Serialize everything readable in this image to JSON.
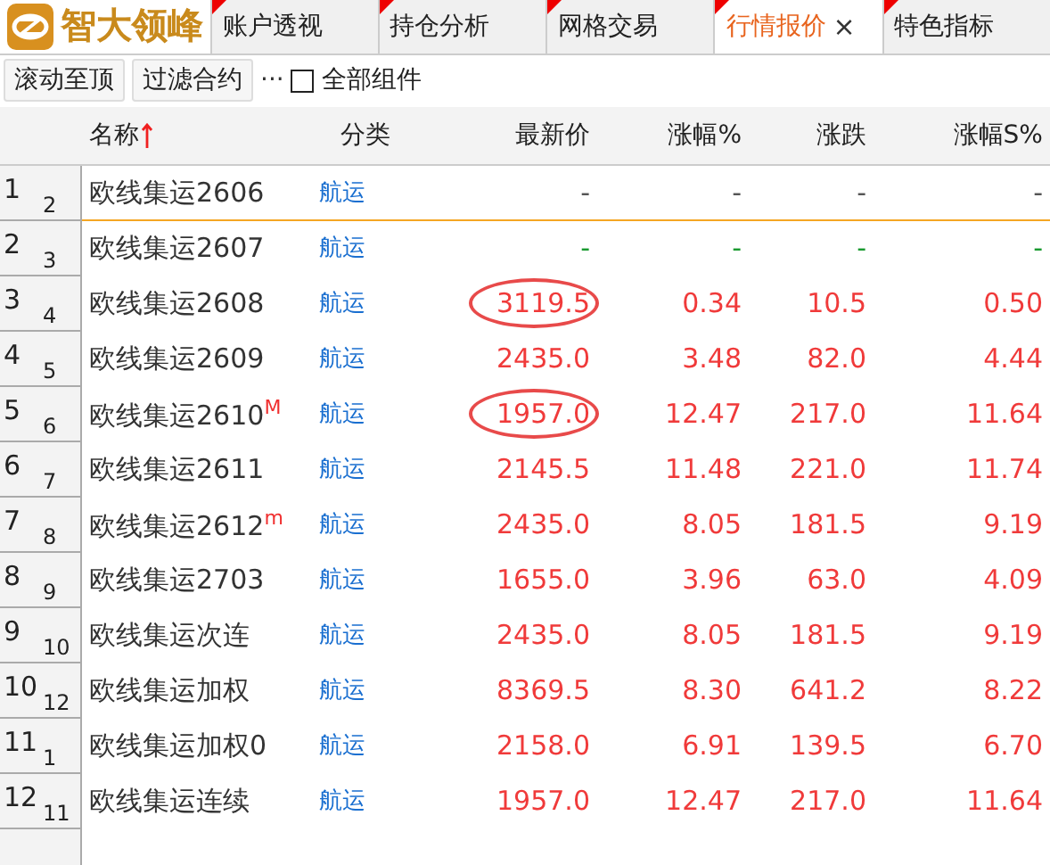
{
  "logo": {
    "text": "智大领峰"
  },
  "tabs": [
    {
      "label": "账户透视",
      "selected": false
    },
    {
      "label": "持仓分析",
      "selected": false
    },
    {
      "label": "网格交易",
      "selected": false
    },
    {
      "label": "行情报价",
      "selected": true,
      "close": "×"
    },
    {
      "label": "特色指标",
      "selected": false
    }
  ],
  "toolbar": {
    "buttons": [
      "滚动至顶",
      "过滤合约"
    ],
    "more": "···",
    "checkbox": {
      "label": "全部组件",
      "checked": false
    }
  },
  "table": {
    "columns": [
      {
        "label": "名称",
        "sorted": true
      },
      {
        "label": "分类",
        "sorted": false
      },
      {
        "label": "最新价",
        "sorted": false
      },
      {
        "label": "涨幅%",
        "sorted": false
      },
      {
        "label": "涨跌",
        "sorted": false
      },
      {
        "label": "涨幅S%",
        "sorted": false
      }
    ],
    "rows": [
      {
        "index": "1",
        "sub": "2",
        "name": "欧线集运2606",
        "mark": "",
        "category": "航运",
        "price": "-",
        "pct": "-",
        "change": "-",
        "pct_s": "-",
        "color": "#555555",
        "circled": false,
        "selected": true
      },
      {
        "index": "2",
        "sub": "3",
        "name": "欧线集运2607",
        "mark": "",
        "category": "航运",
        "price": "-",
        "pct": "-",
        "change": "-",
        "pct_s": "-",
        "color": "#1a9a30",
        "circled": false,
        "selected": false
      },
      {
        "index": "3",
        "sub": "4",
        "name": "欧线集运2608",
        "mark": "",
        "category": "航运",
        "price": "3119.5",
        "pct": "0.34",
        "change": "10.5",
        "pct_s": "0.50",
        "color": "#f03a3a",
        "circled": true,
        "selected": false
      },
      {
        "index": "4",
        "sub": "5",
        "name": "欧线集运2609",
        "mark": "",
        "category": "航运",
        "price": "2435.0",
        "pct": "3.48",
        "change": "82.0",
        "pct_s": "4.44",
        "color": "#f03a3a",
        "circled": false,
        "selected": false
      },
      {
        "index": "5",
        "sub": "6",
        "name": "欧线集运2610",
        "mark": "M",
        "category": "航运",
        "price": "1957.0",
        "pct": "12.47",
        "change": "217.0",
        "pct_s": "11.64",
        "color": "#f03a3a",
        "circled": true,
        "selected": false
      },
      {
        "index": "6",
        "sub": "7",
        "name": "欧线集运2611",
        "mark": "",
        "category": "航运",
        "price": "2145.5",
        "pct": "11.48",
        "change": "221.0",
        "pct_s": "11.74",
        "color": "#f03a3a",
        "circled": false,
        "selected": false
      },
      {
        "index": "7",
        "sub": "8",
        "name": "欧线集运2612",
        "mark": "m",
        "category": "航运",
        "price": "2435.0",
        "pct": "8.05",
        "change": "181.5",
        "pct_s": "9.19",
        "color": "#f03a3a",
        "circled": false,
        "selected": false
      },
      {
        "index": "8",
        "sub": "9",
        "name": "欧线集运2703",
        "mark": "",
        "category": "航运",
        "price": "1655.0",
        "pct": "3.96",
        "change": "63.0",
        "pct_s": "4.09",
        "color": "#f03a3a",
        "circled": false,
        "selected": false
      },
      {
        "index": "9",
        "sub": "10",
        "name": "欧线集运次连",
        "mark": "",
        "category": "航运",
        "price": "2435.0",
        "pct": "8.05",
        "change": "181.5",
        "pct_s": "9.19",
        "color": "#f03a3a",
        "circled": false,
        "selected": false
      },
      {
        "index": "10",
        "sub": "12",
        "name": "欧线集运加权",
        "mark": "",
        "category": "航运",
        "price": "8369.5",
        "pct": "8.30",
        "change": "641.2",
        "pct_s": "8.22",
        "color": "#f03a3a",
        "circled": false,
        "selected": false
      },
      {
        "index": "11",
        "sub": "1",
        "name": "欧线集运加权0",
        "mark": "",
        "category": "航运",
        "price": "2158.0",
        "pct": "6.91",
        "change": "139.5",
        "pct_s": "6.70",
        "color": "#f03a3a",
        "circled": false,
        "selected": false
      },
      {
        "index": "12",
        "sub": "11",
        "name": "欧线集运连续",
        "mark": "",
        "category": "航运",
        "price": "1957.0",
        "pct": "12.47",
        "change": "217.0",
        "pct_s": "11.64",
        "color": "#f03a3a",
        "circled": false,
        "selected": false
      }
    ]
  }
}
